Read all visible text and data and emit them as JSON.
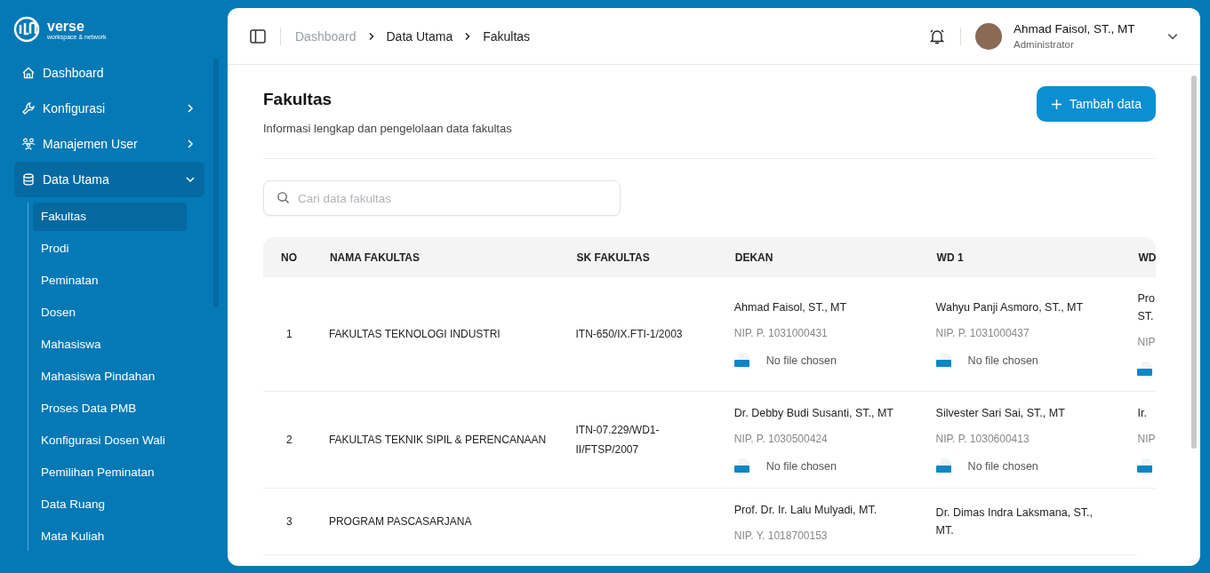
{
  "logo": {
    "text": "verse",
    "tagline": "workspace & network"
  },
  "sidebar": {
    "items": [
      {
        "label": "Dashboard",
        "expanded": false,
        "has_children": false,
        "selected": false
      },
      {
        "label": "Konfigurasi",
        "expanded": false,
        "has_children": true,
        "selected": false
      },
      {
        "label": "Manajemen User",
        "expanded": false,
        "has_children": true,
        "selected": false
      },
      {
        "label": "Data Utama",
        "expanded": true,
        "has_children": true,
        "selected": true,
        "children": [
          {
            "label": "Fakultas",
            "selected": true
          },
          {
            "label": "Prodi",
            "selected": false
          },
          {
            "label": "Peminatan",
            "selected": false
          },
          {
            "label": "Dosen",
            "selected": false
          },
          {
            "label": "Mahasiswa",
            "selected": false
          },
          {
            "label": "Mahasiswa Pindahan",
            "selected": false
          },
          {
            "label": "Proses Data PMB",
            "selected": false
          },
          {
            "label": "Konfigurasi Dosen Wali",
            "selected": false
          },
          {
            "label": "Pemilihan Peminatan",
            "selected": false
          },
          {
            "label": "Data Ruang",
            "selected": false
          },
          {
            "label": "Mata Kuliah",
            "selected": false
          }
        ]
      }
    ]
  },
  "breadcrumb": [
    "Dashboard",
    "Data Utama",
    "Fakultas"
  ],
  "user": {
    "name": "Ahmad Faisol, ST., MT",
    "role": "Administrator"
  },
  "page": {
    "title": "Fakultas",
    "subtitle": "Informasi lengkap dan pengelolaan data fakultas",
    "add_button": "Tambah data"
  },
  "search": {
    "placeholder": "Cari data fakultas"
  },
  "table": {
    "columns": [
      "NO",
      "NAMA FAKULTAS",
      "SK FAKULTAS",
      "DEKAN",
      "WD 1",
      "WD"
    ],
    "rows": [
      {
        "no": "1",
        "name": "FAKULTAS TEKNOLOGI INDUSTRI",
        "sk": "ITN-650/IX.FTI-1/2003",
        "people": [
          {
            "name": "Ahmad Faisol, ST., MT",
            "nip": "NIP. P. 1031000431",
            "file": "No file chosen"
          },
          {
            "name": "Wahyu Panji Asmoro, ST., MT",
            "nip": "NIP. P. 1031000437",
            "file": "No file chosen"
          },
          {
            "name": "Pro ST.",
            "nip": "NIP"
          }
        ]
      },
      {
        "no": "2",
        "name": "FAKULTAS TEKNIK SIPIL & PERENCANAAN",
        "sk": "ITN-07.229/WD1-II/FTSP/2007",
        "people": [
          {
            "name": "Dr. Debby Budi Susanti, ST., MT",
            "nip": "NIP. P. 1030500424",
            "file": "No file chosen"
          },
          {
            "name": "Silvester Sari Sai, ST., MT",
            "nip": "NIP. P. 1030600413",
            "file": "No file chosen"
          },
          {
            "name": "Ir.",
            "nip": "NIP"
          }
        ]
      },
      {
        "no": "3",
        "name": "PROGRAM PASCASARJANA",
        "people": [
          {
            "name": "Prof. Dr. Ir. Lalu Mulyadi, MT.",
            "nip": "NIP. Y. 1018700153"
          },
          {
            "name": "Dr. Dimas Indra Laksmana, ST., MT."
          }
        ]
      }
    ]
  }
}
